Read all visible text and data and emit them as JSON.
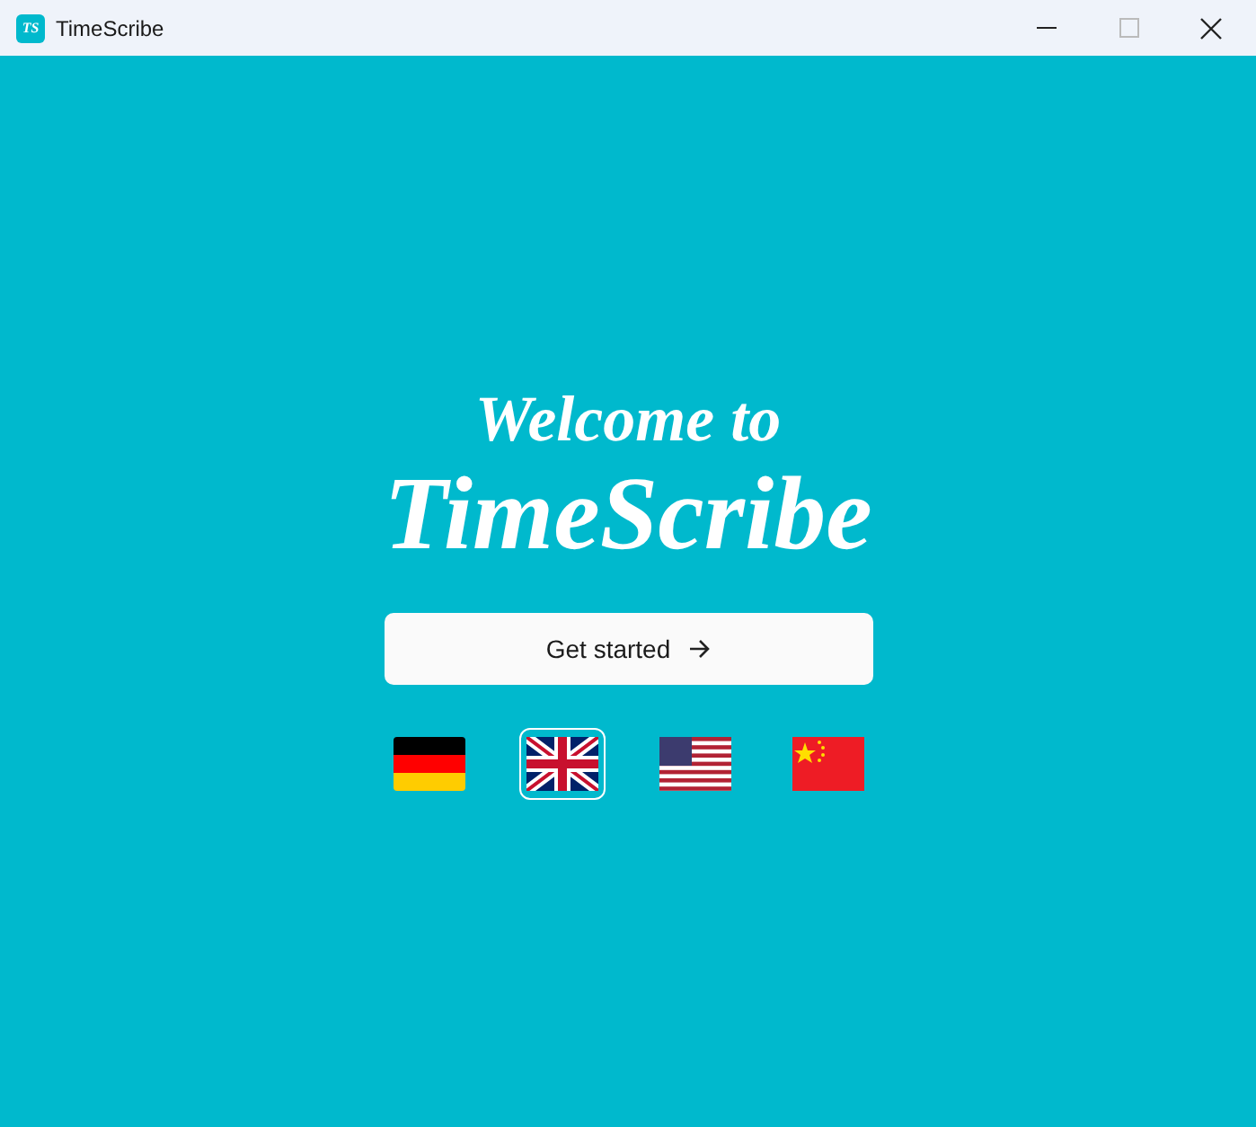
{
  "window": {
    "title": "TimeScribe",
    "app_icon": "TS"
  },
  "welcome": {
    "line_1": "Welcome to",
    "line_2": "TimeScribe"
  },
  "start_button": {
    "label": "Get started"
  },
  "languages": [
    {
      "kind": "de",
      "selected": false
    },
    {
      "kind": "gb",
      "selected": true
    },
    {
      "kind": "us",
      "selected": false
    },
    {
      "kind": "cn",
      "selected": false
    }
  ]
}
